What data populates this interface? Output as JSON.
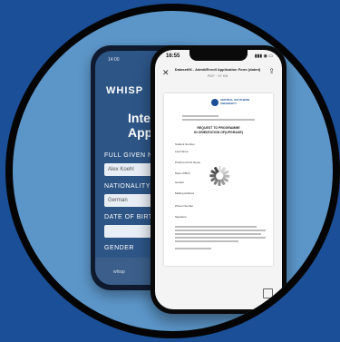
{
  "back_app": {
    "status_time": "14:00",
    "logo": "WHISP",
    "title": "Inter\nApplica",
    "fields": [
      {
        "label": "FULL GIVEN NAME",
        "value": "Alex Koehl"
      },
      {
        "label": "NATIONALITY",
        "value": "German"
      },
      {
        "label": "DATE OF BIRTH",
        "value": ""
      },
      {
        "label": "GENDER",
        "value": ""
      }
    ],
    "bottom_text": "whisp"
  },
  "viewer": {
    "status_time": "16:55",
    "status_icons": "▮▮▮ ◉ ▭",
    "document_title": "Dataset06 - Admit/Enroll Application Form (dated)",
    "document_meta": "PDF · 97 KB",
    "university_name": "CENTRAL SOUTHERN\nUNIVERSITY",
    "page_heading": "REQUEST TO PROGRAMME\nIN ORIENTATION OF(UPGRADE)",
    "page_labels": [
      "Student Number",
      "Last Name",
      "Preferred First Name",
      "Date of Birth",
      "Gender",
      "Mailing Address",
      "Phone Number",
      "Signature"
    ]
  },
  "colors": {
    "background": "#1b4f98",
    "circle_fill": "#5c96c9",
    "ring": "#050505",
    "spinner": "#444444"
  }
}
